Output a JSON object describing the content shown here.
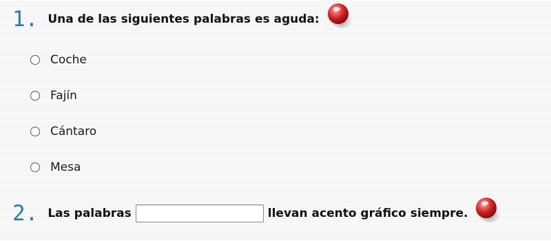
{
  "questions": [
    {
      "number": "1.",
      "text": "Una de las siguientes palabras es aguda:",
      "check_icon": "red-ball-check-icon",
      "options": [
        "Coche",
        "Fajín",
        "Cántaro",
        "Mesa"
      ]
    },
    {
      "number": "2.",
      "text_before": "Las palabras",
      "blank_value": "",
      "text_after": "llevan acento gráfico siempre.",
      "check_icon": "red-ball-check-icon"
    }
  ],
  "colors": {
    "number": "#2a7da4",
    "check_ball": "#c91f1f"
  }
}
